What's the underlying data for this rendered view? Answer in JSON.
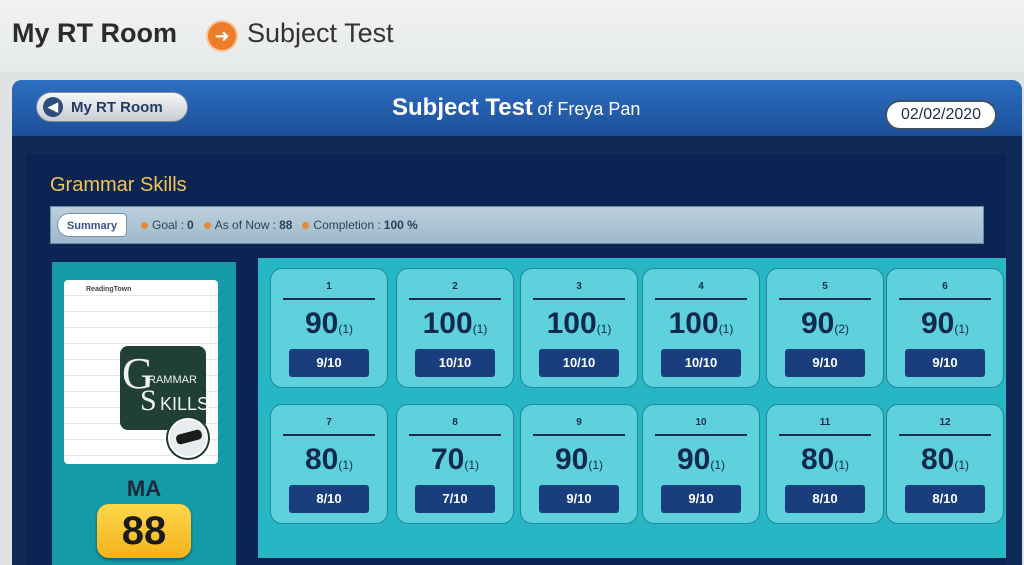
{
  "header": {
    "root": "My RT Room",
    "current": "Subject Test"
  },
  "titlebar": {
    "back_label": "My RT Room",
    "title": "Subject Test",
    "of_label": "of Freya Pan",
    "date": "02/02/2020"
  },
  "section": {
    "title": "Grammar Skills"
  },
  "summary": {
    "tab": "Summary",
    "goal_label": "Goal :",
    "goal": "0",
    "asof_label": "As of Now :",
    "asof": "88",
    "completion_label": "Completion :",
    "completion": "100 %"
  },
  "skill": {
    "card_logo": "ReadingTown",
    "logo_line1": "RAMMAR",
    "logo_line2": "KILLS",
    "initials": "MA",
    "score": "88"
  },
  "tests": [
    {
      "num": "1",
      "score": "90",
      "attempts": "(1)",
      "fraction": "9/10"
    },
    {
      "num": "2",
      "score": "100",
      "attempts": "(1)",
      "fraction": "10/10"
    },
    {
      "num": "3",
      "score": "100",
      "attempts": "(1)",
      "fraction": "10/10"
    },
    {
      "num": "4",
      "score": "100",
      "attempts": "(1)",
      "fraction": "10/10"
    },
    {
      "num": "5",
      "score": "90",
      "attempts": "(2)",
      "fraction": "9/10"
    },
    {
      "num": "6",
      "score": "90",
      "attempts": "(1)",
      "fraction": "9/10"
    },
    {
      "num": "7",
      "score": "80",
      "attempts": "(1)",
      "fraction": "8/10"
    },
    {
      "num": "8",
      "score": "70",
      "attempts": "(1)",
      "fraction": "7/10"
    },
    {
      "num": "9",
      "score": "90",
      "attempts": "(1)",
      "fraction": "9/10"
    },
    {
      "num": "10",
      "score": "90",
      "attempts": "(1)",
      "fraction": "9/10"
    },
    {
      "num": "11",
      "score": "80",
      "attempts": "(1)",
      "fraction": "8/10"
    },
    {
      "num": "12",
      "score": "80",
      "attempts": "(1)",
      "fraction": "8/10"
    }
  ]
}
